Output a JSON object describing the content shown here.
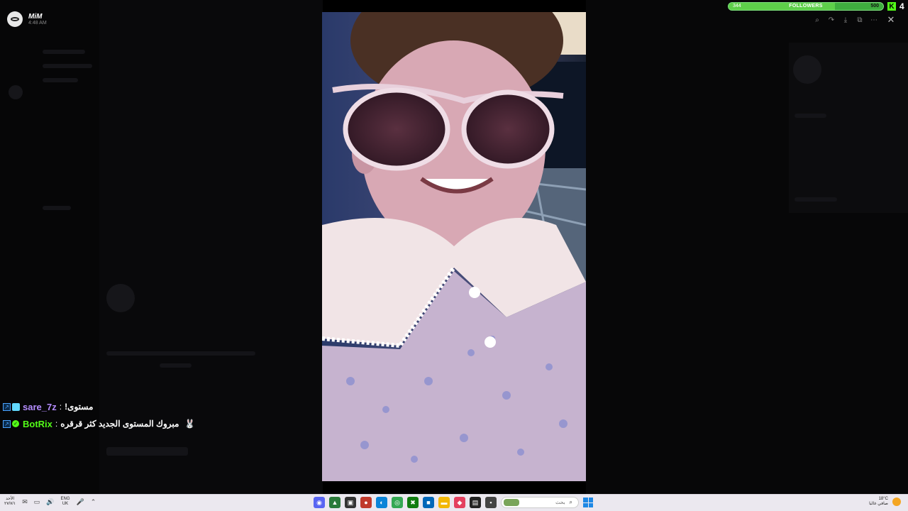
{
  "viewer": {
    "username": "MiM",
    "time": "4:48 AM"
  },
  "toolbar": {
    "zoom_icon": "zoom-icon",
    "share_icon": "share-icon",
    "download_icon": "download-icon",
    "open_icon": "open-external-icon",
    "more_icon": "more-icon",
    "close_icon": "close-icon"
  },
  "followers": {
    "label": "FOLLOWERS",
    "current": "344",
    "goal": "500",
    "progress": 0.688
  },
  "kick": {
    "logo_letter": "K",
    "count": "4"
  },
  "chat": {
    "messages": [
      {
        "user": "sare_7z",
        "separator": ":",
        "text": "مستوى!",
        "user_color": "#b48cff"
      },
      {
        "user": "BotRix",
        "separator": ":",
        "text": "مبروك المستوى الجديد كثر قرقره",
        "user_color": "#53fc18"
      }
    ]
  },
  "taskbar": {
    "date_line1": "الأحد",
    "date_line2": "٢٧/٧/١",
    "lang_line1": "ENG",
    "lang_line2": "UK",
    "search_placeholder": "بحث",
    "weather_line1": "18°C",
    "weather_line2": "صافي غالبا"
  }
}
